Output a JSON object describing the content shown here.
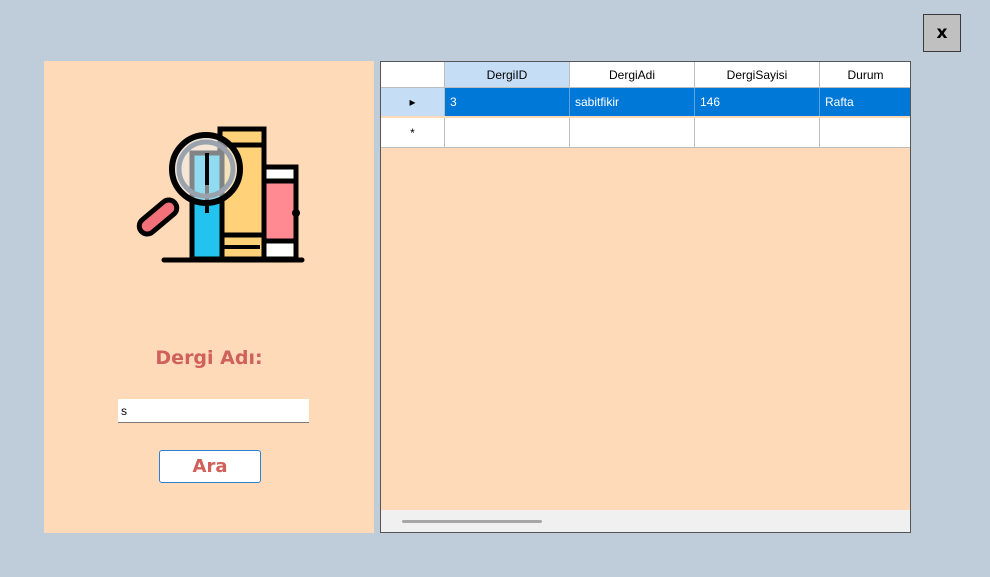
{
  "window": {
    "close_label": "x"
  },
  "search": {
    "label": "Dergi Adı:",
    "input_value": "s",
    "button_label": "Ara"
  },
  "grid": {
    "columns": [
      "DergiID",
      "DergiAdi",
      "DergiSayisi",
      "Durum"
    ],
    "rows": [
      {
        "indicator": "▸",
        "cells": [
          "3",
          "sabitfikir",
          "146",
          "Rafta"
        ]
      }
    ],
    "new_row_indicator": "*"
  },
  "colors": {
    "background": "#bfcddb",
    "panel": "#ffdab9",
    "accent_text": "#d0605a",
    "selection": "#0078d7"
  },
  "icons": {
    "illustration": "books-magnifier-icon"
  }
}
